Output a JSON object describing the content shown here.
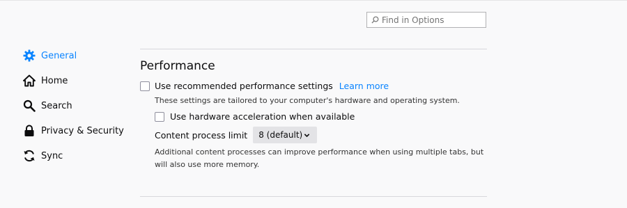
{
  "search": {
    "placeholder": "Find in Options"
  },
  "sidebar": {
    "items": [
      {
        "label": "General",
        "icon": "gear-icon",
        "active": true
      },
      {
        "label": "Home",
        "icon": "home-icon"
      },
      {
        "label": "Search",
        "icon": "search-icon"
      },
      {
        "label": "Privacy & Security",
        "icon": "lock-icon"
      },
      {
        "label": "Sync",
        "icon": "sync-icon"
      }
    ]
  },
  "performance": {
    "title": "Performance",
    "recommended_label": "Use recommended performance settings",
    "learn_more": "Learn more",
    "recommended_note": "These settings are tailored to your computer's hardware and operating system.",
    "hw_accel_label": "Use hardware acceleration when available",
    "process_limit_label": "Content process limit",
    "process_limit_value": "8 (default)",
    "process_note": "Additional content processes can improve performance when using multiple tabs, but will also use more memory."
  },
  "colors": {
    "accent": "#0a84ff",
    "background": "#f9f9fa"
  }
}
